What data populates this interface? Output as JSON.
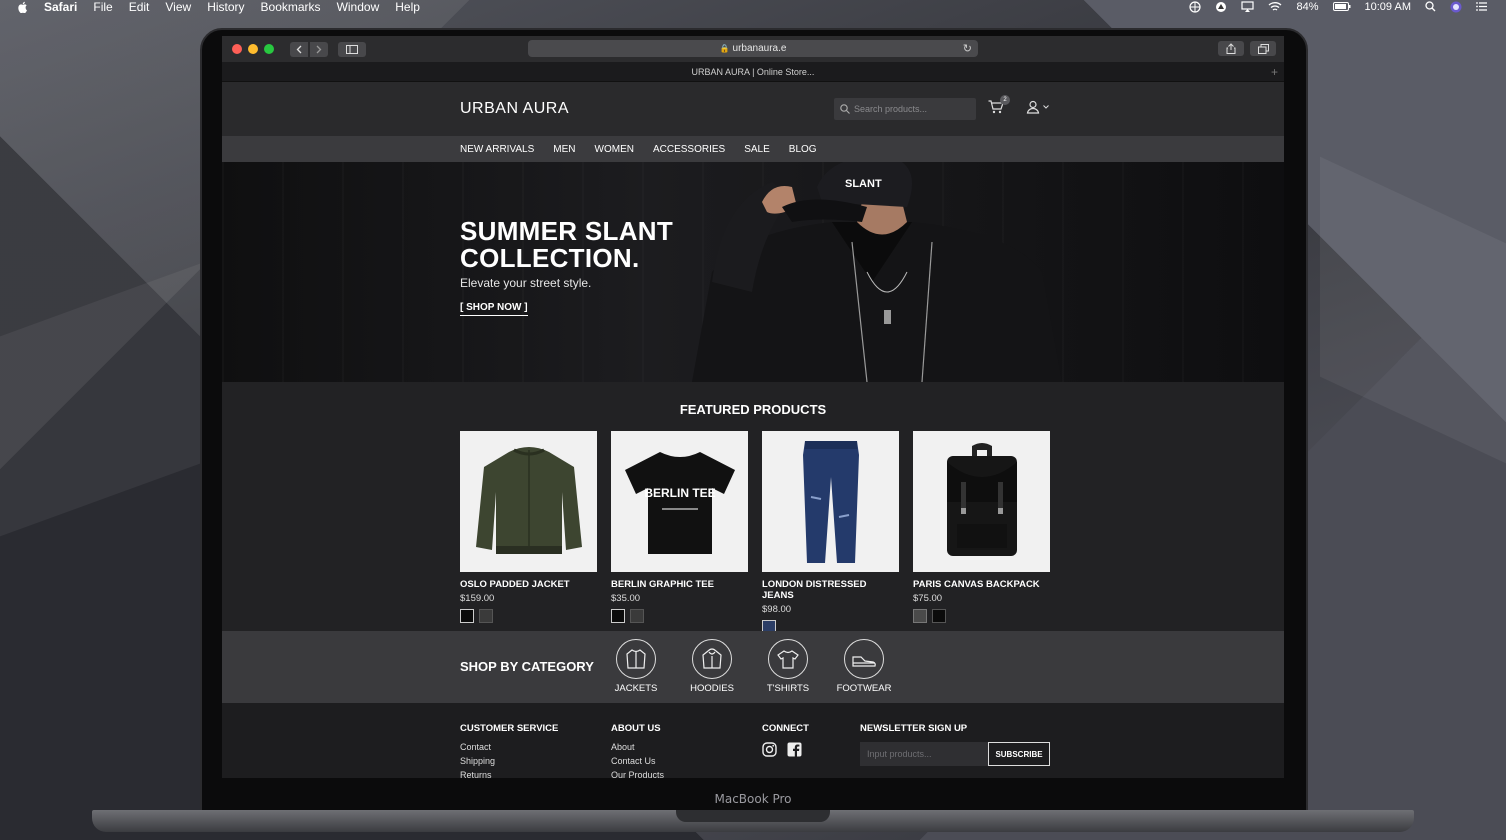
{
  "menubar": {
    "app": "Safari",
    "items": [
      "File",
      "Edit",
      "View",
      "History",
      "Bookmarks",
      "Window",
      "Help"
    ],
    "battery": "84%",
    "time": "10:09 AM"
  },
  "browser": {
    "url": "urbanaura.e",
    "tab_title": "URBAN AURA | Online Store..."
  },
  "site": {
    "logo": "URBAN AURA",
    "search_placeholder": "Search products...",
    "cart_count": "2",
    "nav": [
      "NEW ARRIVALS",
      "MEN",
      "WOMEN",
      "ACCESSORIES",
      "SALE",
      "BLOG"
    ],
    "hero": {
      "title_line1": "SUMMER SLANT",
      "title_line2": "COLLECTION.",
      "subtitle": "Elevate your street style.",
      "cta": "[ SHOP NOW ]",
      "cap_text": "SLANT"
    },
    "featured_title": "FEATURED PRODUCTS",
    "products": [
      {
        "name": "OSLO PADDED JACKET",
        "price": "$159.00",
        "swatches": [
          "#0b0b0b",
          "#3a3a3a"
        ]
      },
      {
        "name": "BERLIN GRAPHIC TEE",
        "price": "$35.00",
        "swatches": [
          "#0b0b0b",
          "#3a3a3a"
        ],
        "print": "BERLIN TEE"
      },
      {
        "name": "LONDON DISTRESSED JEANS",
        "price": "$98.00",
        "swatches": [
          "#2c3e66"
        ]
      },
      {
        "name": "PARIS CANVAS BACKPACK",
        "price": "$75.00",
        "swatches": [
          "#4a4a4a",
          "#0b0b0b"
        ]
      }
    ],
    "category_title": "SHOP BY CATEGORY",
    "categories": [
      "JACKETS",
      "HOODIES",
      "T'SHIRTS",
      "FOOTWEAR"
    ],
    "footer": {
      "customer_service": {
        "title": "CUSTOMER SERVICE",
        "links": [
          "Contact",
          "Shipping",
          "Returns"
        ]
      },
      "about": {
        "title": "ABOUT US",
        "links": [
          "About",
          "Contact Us",
          "Our Products"
        ]
      },
      "connect": {
        "title": "CONNECT"
      },
      "newsletter": {
        "title": "NEWSLETTER SIGN UP",
        "placeholder": "Input products...",
        "button": "SUBSCRIBE"
      }
    }
  },
  "device_label": "MacBook Pro",
  "colors": {
    "accent": "#ffffff",
    "header_bg": "#2a2a2c",
    "nav_bg": "#3b3b3e"
  }
}
